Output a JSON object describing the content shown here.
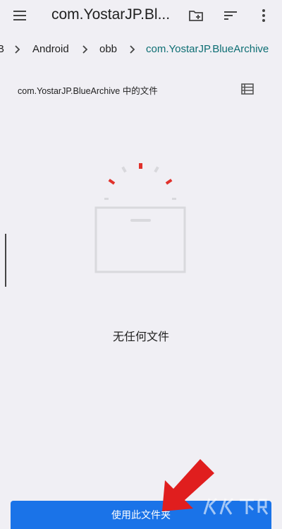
{
  "app_bar": {
    "title": "com.YostarJP.Bl..."
  },
  "breadcrumb": {
    "items": [
      "B",
      "Android",
      "obb",
      "com.YostarJP.BlueArchive"
    ]
  },
  "folder_header": {
    "label": "com.YostarJP.BlueArchive 中的文件"
  },
  "empty_state": {
    "text": "无任何文件"
  },
  "bottom": {
    "use_folder_label": "使用此文件夹"
  },
  "colors": {
    "accent": "#1a73e8",
    "active_crumb": "#0d6e73",
    "annotation_arrow": "#e01e1e",
    "background": "#f0eff4"
  }
}
